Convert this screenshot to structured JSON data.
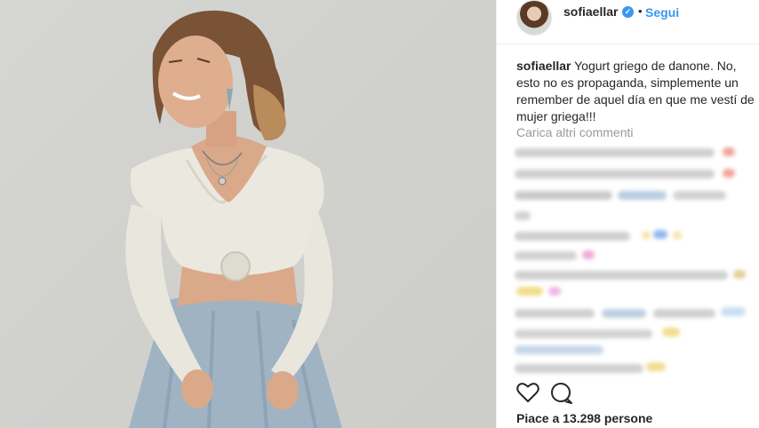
{
  "post": {
    "username": "sofiaellar",
    "follow_label": "Segui",
    "separator": "•",
    "verified_glyph": "✓",
    "caption_user": "sofiaellar",
    "caption_text": "Yogurt griego de danone. No, esto no es propaganda, simplemente un remember de aquel día en que me vestí de mujer griega!!!",
    "load_more_label": "Carica altri commenti",
    "likes_text": "Piace a 13.298 persone"
  },
  "icons": {
    "like": "heart-icon",
    "comment": "comment-icon",
    "verified": "verified-badge-icon"
  },
  "colors": {
    "link_blue": "#3897f0",
    "text": "#262626",
    "muted": "#999999",
    "divider": "#efefef"
  }
}
